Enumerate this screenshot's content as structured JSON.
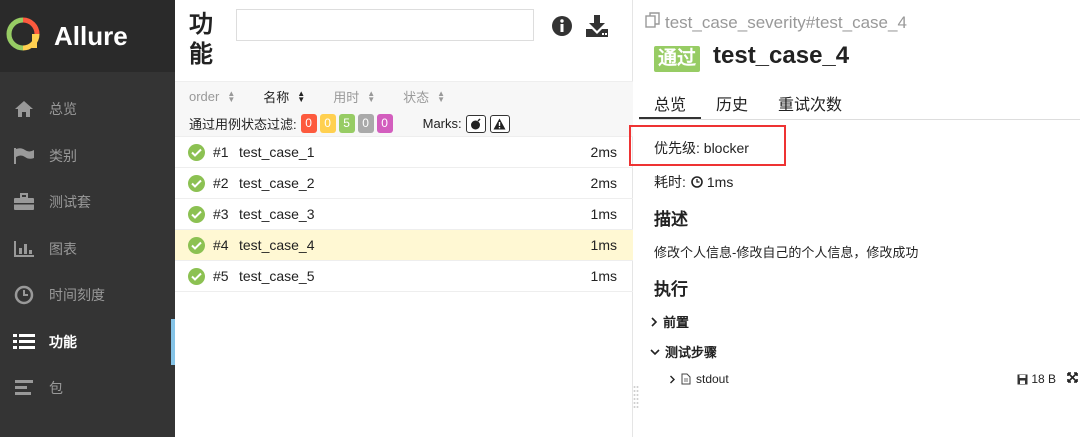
{
  "brand": {
    "name": "Allure"
  },
  "sidebar": {
    "items": [
      {
        "label": "总览",
        "icon": "home-icon"
      },
      {
        "label": "类别",
        "icon": "flag-icon"
      },
      {
        "label": "测试套",
        "icon": "briefcase-icon"
      },
      {
        "label": "图表",
        "icon": "bar-chart-icon"
      },
      {
        "label": "时间刻度",
        "icon": "clock-icon"
      },
      {
        "label": "功能",
        "icon": "list-icon",
        "active": true
      },
      {
        "label": "包",
        "icon": "align-left-icon"
      }
    ]
  },
  "mid": {
    "title": "功能",
    "search": {
      "value": "",
      "placeholder": ""
    },
    "sort": {
      "order": "order",
      "name": "名称",
      "duration": "用时",
      "status": "状态"
    },
    "filter": {
      "label": "通过用例状态过滤:",
      "counts": [
        {
          "value": "0",
          "color": "#fd5a3e"
        },
        {
          "value": "0",
          "color": "#ffd050"
        },
        {
          "value": "5",
          "color": "#97cc64"
        },
        {
          "value": "0",
          "color": "#aaaaaa"
        },
        {
          "value": "0",
          "color": "#d35ebe"
        }
      ],
      "marks_label": "Marks:"
    },
    "rows": [
      {
        "num": "#1",
        "name": "test_case_1",
        "duration": "2ms"
      },
      {
        "num": "#2",
        "name": "test_case_2",
        "duration": "2ms"
      },
      {
        "num": "#3",
        "name": "test_case_3",
        "duration": "1ms"
      },
      {
        "num": "#4",
        "name": "test_case_4",
        "duration": "1ms",
        "selected": true
      },
      {
        "num": "#5",
        "name": "test_case_5",
        "duration": "1ms"
      }
    ]
  },
  "detail": {
    "breadcrumb": "test_case_severity#test_case_4",
    "status": "通过",
    "title": "test_case_4",
    "tabs": [
      "总览",
      "历史",
      "重试次数"
    ],
    "priority": "优先级: blocker",
    "duration_label": "耗时:",
    "duration_value": "1ms",
    "desc_heading": "描述",
    "desc_text": "修改个人信息-修改自己的个人信息，修改成功",
    "exec_heading": "执行",
    "setup_label": "前置",
    "steps_label": "测试步骤",
    "attachment": {
      "name": "stdout",
      "size": "18 B"
    }
  },
  "colors": {
    "passed": "#97cc64",
    "check": "#8cc152",
    "highlight_box": "#ee3333",
    "selected_row": "#fff8d3"
  }
}
